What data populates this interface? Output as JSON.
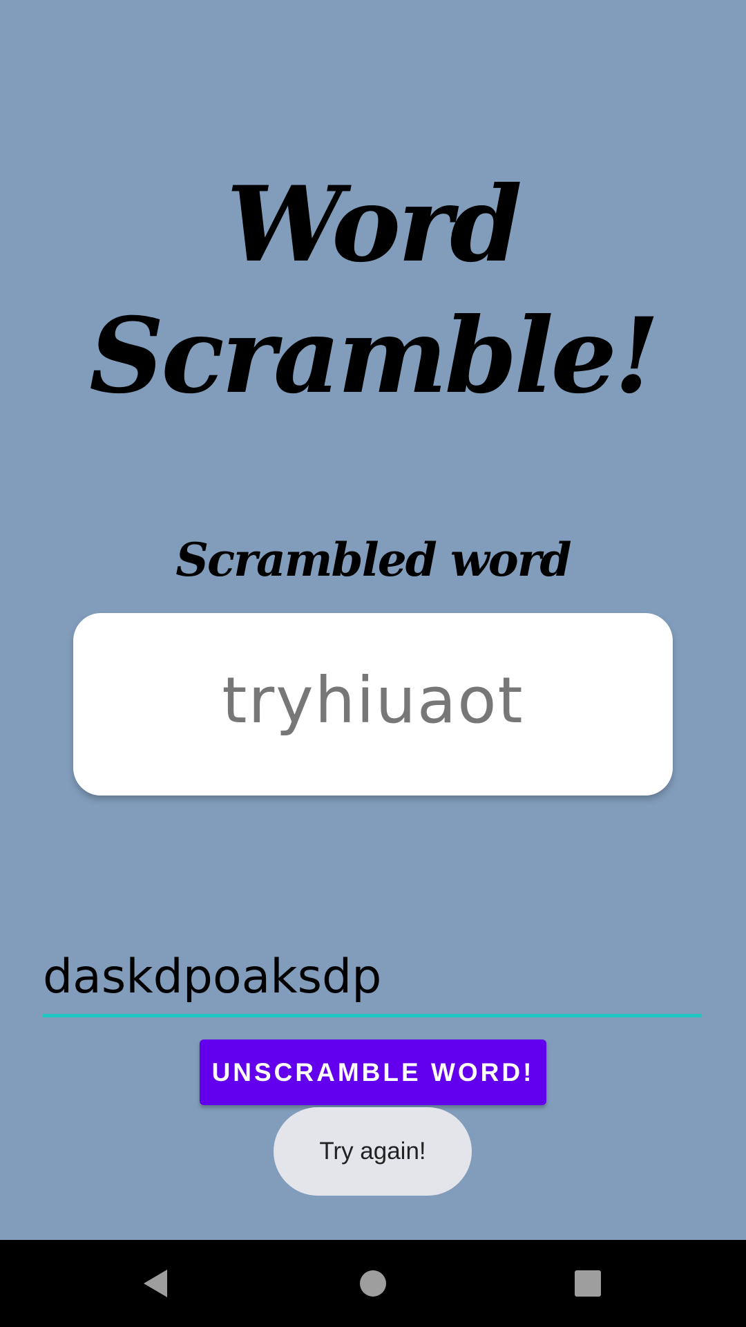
{
  "app": {
    "title": "Word Scramble!",
    "subtitle": "Scrambled word",
    "scrambled_word": "tryhiuaot",
    "answer_value": "daskdpoaksdp",
    "button_label": "UNSCRAMBLE WORD!",
    "toast_message": "Try again!"
  },
  "colors": {
    "background": "#829DBC",
    "button": "#6200EE",
    "input_underline": "#1FC8C0",
    "card": "#FFFFFF",
    "toast": "#E4E5EA",
    "nav_bar": "#000000"
  },
  "nav_bar": {
    "buttons": [
      "back-icon",
      "home-icon",
      "recents-icon"
    ]
  }
}
